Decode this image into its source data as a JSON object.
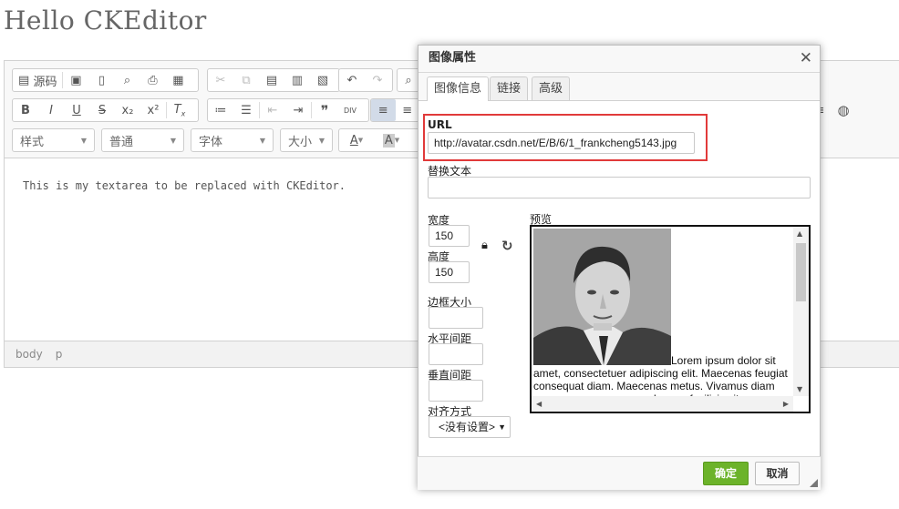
{
  "page": {
    "title": "Hello CKEditor"
  },
  "editor": {
    "content_text": "This is my textarea to be replaced with CKEditor.",
    "source_label": "源码",
    "combos": {
      "style": "样式",
      "format": "普通",
      "font": "字体",
      "size": "大小"
    },
    "status_path": [
      "body",
      "p"
    ]
  },
  "dialog": {
    "title": "图像属性",
    "tabs": [
      "图像信息",
      "链接",
      "高级"
    ],
    "url_label": "URL",
    "url_value": "http://avatar.csdn.net/E/B/6/1_frankcheng5143.jpg",
    "alt_label": "替换文本",
    "alt_value": "",
    "width_label": "宽度",
    "width_value": "150",
    "height_label": "高度",
    "height_value": "150",
    "border_label": "边框大小",
    "hspace_label": "水平间距",
    "vspace_label": "垂直间距",
    "align_label": "对齐方式",
    "align_value": "<没有设置>",
    "preview_label": "预览",
    "preview_text": "Lorem ipsum dolor sit amet, consectetuer adipiscing elit. Maecenas feugiat consequat diam. Maecenas metus. Vivamus diam purus, cursus a, commodo non, facilisis vitae",
    "ok_label": "确定",
    "cancel_label": "取消"
  },
  "colors": {
    "ok_button": "#6cb32a",
    "highlight_box": "#e13a3a"
  }
}
